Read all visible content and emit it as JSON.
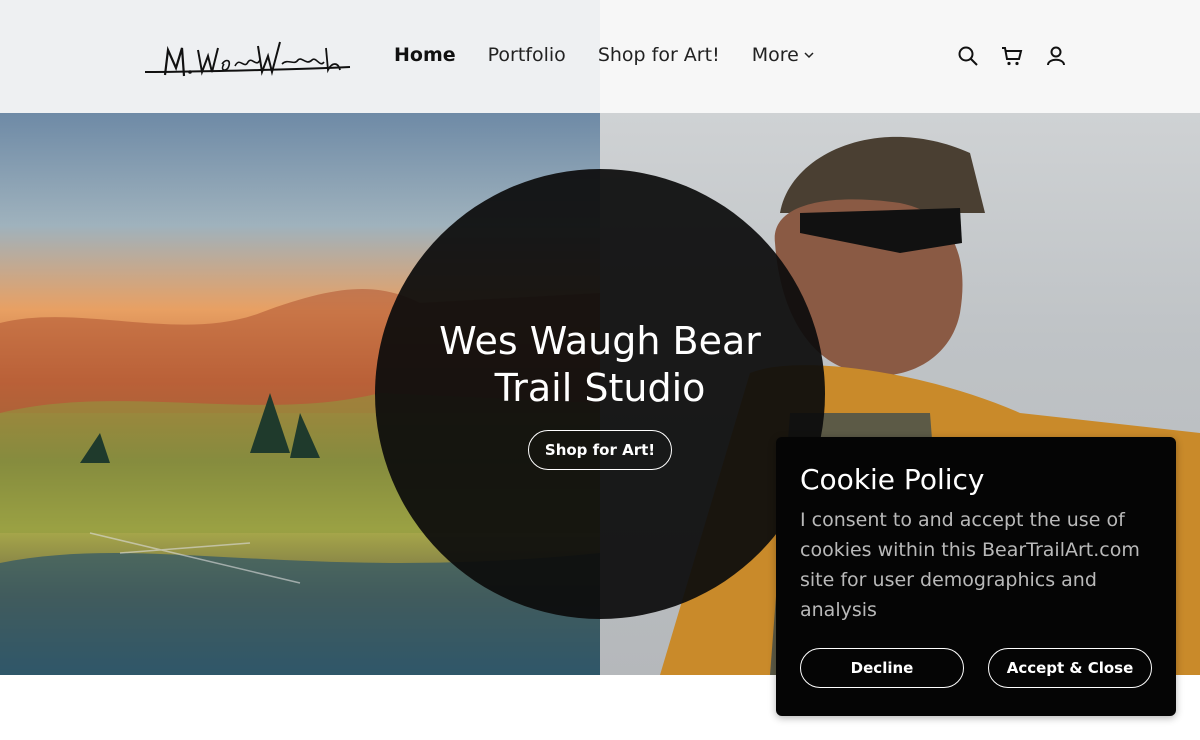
{
  "nav": {
    "items": [
      {
        "label": "Home"
      },
      {
        "label": "Portfolio"
      },
      {
        "label": "Shop for Art!"
      },
      {
        "label": "More"
      }
    ]
  },
  "header": {
    "logo_text": "M. Wesley Waugh",
    "icons": [
      "search-icon",
      "cart-icon",
      "user-icon"
    ]
  },
  "hero": {
    "title": "Wes Waugh Bear Trail Studio",
    "button_label": "Shop for Art!"
  },
  "cookie": {
    "title": "Cookie Policy",
    "text": "I consent to and accept the use of cookies within this BearTrailArt.com site for user demographics and analysis",
    "decline_label": "Decline",
    "accept_label": "Accept & Close"
  },
  "colors": {
    "overlay": "#0c0c0c",
    "cookie_bg": "#050505",
    "text_light": "#ffffff",
    "text_muted": "#b9b9b9"
  }
}
